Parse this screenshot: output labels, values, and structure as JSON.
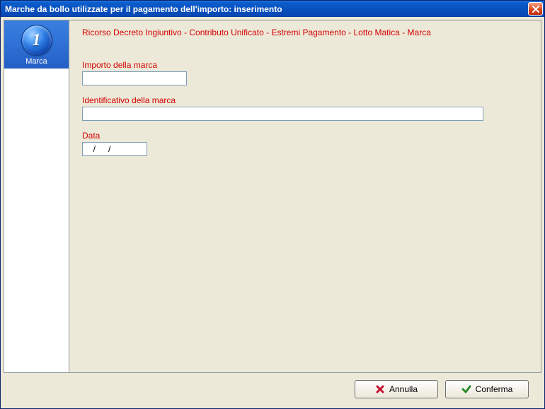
{
  "window": {
    "title": "Marche da bollo utilizzate per il pagamento dell'importo: inserimento"
  },
  "sidebar": {
    "step_number": "1",
    "step_label": "Marca"
  },
  "breadcrumb": "Ricorso Decreto Ingiuntivo - Contributo Unificato - Estremi Pagamento - Lotto Matica - Marca",
  "fields": {
    "importo": {
      "label": "Importo della marca",
      "value": ""
    },
    "identificativo": {
      "label": "Identificativo della marca",
      "value": ""
    },
    "data": {
      "label": "Data",
      "value": "  /   /"
    }
  },
  "buttons": {
    "cancel": "Annulla",
    "confirm": "Conferma"
  }
}
